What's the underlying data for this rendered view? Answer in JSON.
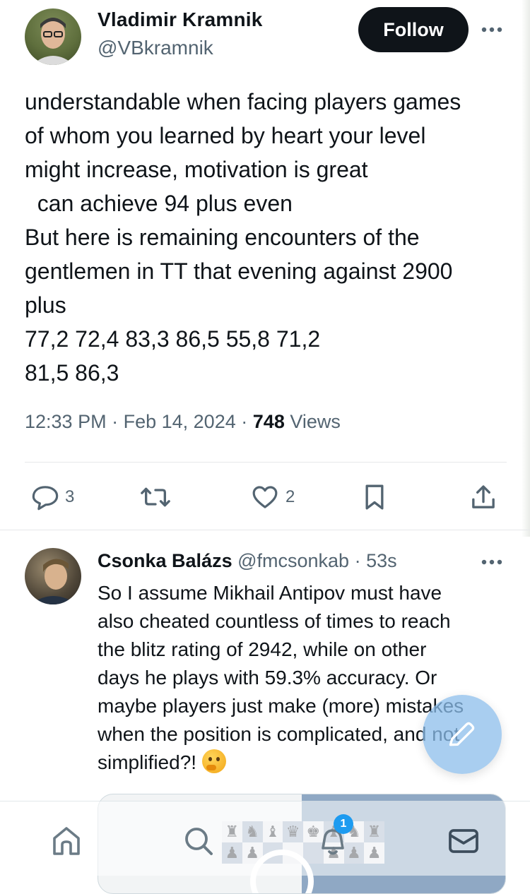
{
  "tweet": {
    "author_name": "Vladimir Kramnik",
    "author_handle": "@VBkramnik",
    "follow_label": "Follow",
    "text_lines": [
      "understandable when facing players games",
      "of whom you learned by heart your level",
      "might increase, motivation is great",
      "  can achieve 94 plus even",
      "But here is remaining encounters of the",
      "gentlemen in TT that evening against 2900",
      "plus",
      "77,2 72,4 83,3 86,5 55,8 71,2",
      "81,5 86,3"
    ],
    "time": "12:33 PM",
    "sep": "·",
    "date": "Feb 14, 2024",
    "views_count": "748",
    "views_label": "Views",
    "actions": {
      "reply_count": "3",
      "like_count": "2"
    }
  },
  "reply": {
    "author_name": "Csonka Balázs",
    "author_handle": "@fmcsonkab",
    "sep": "·",
    "time": "53s",
    "text_lines": [
      "So I assume Mikhail Antipov must have",
      "also cheated countless of times to reach",
      "the blitz rating of 2942, while on other",
      "days he plays with 59.3% accuracy. Or",
      "maybe players just make (more) mistakes",
      "when the position is complicated, and not",
      "simplified?! "
    ],
    "emoji": "thinking-face"
  },
  "bottom_nav": {
    "notification_badge": "1",
    "items": [
      "home-icon",
      "search-icon",
      "notifications-icon",
      "messages-icon"
    ]
  },
  "colors": {
    "text_primary": "#0f1419",
    "text_secondary": "#536471",
    "accent": "#1d9bf0",
    "follow_bg": "#0f1419",
    "divider": "#e6e8ea"
  }
}
